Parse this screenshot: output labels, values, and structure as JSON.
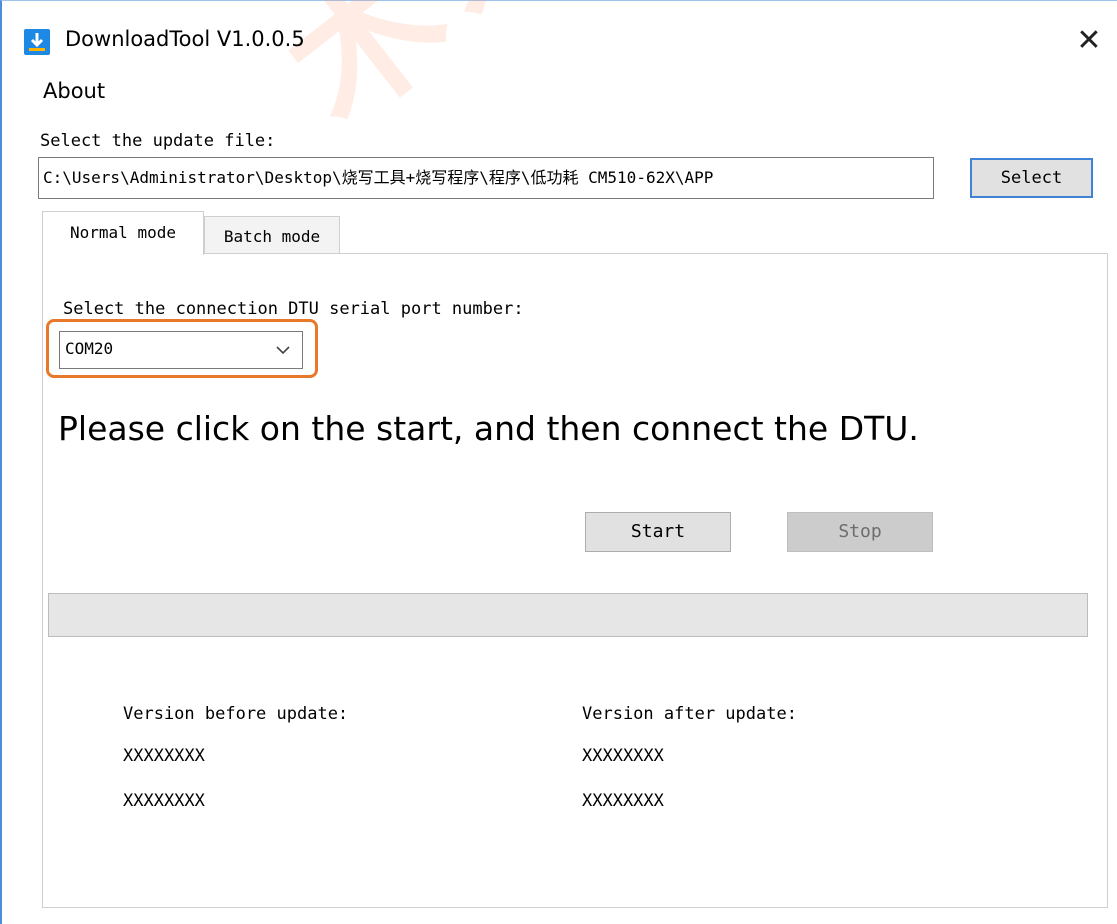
{
  "window": {
    "title": "DownloadTool V1.0.0.5",
    "close_symbol": "✕",
    "icon": "download-app-icon"
  },
  "menu": {
    "about": "About"
  },
  "update_file": {
    "label": "Select the update file:",
    "path": "C:\\Users\\Administrator\\Desktop\\烧写工具+烧写程序\\程序\\低功耗 CM510-62X\\APP",
    "select_button": "Select"
  },
  "tabs": [
    {
      "label": "Normal mode",
      "selected": true
    },
    {
      "label": "Batch mode",
      "selected": false
    }
  ],
  "normal_mode": {
    "port_label": "Select the connection DTU serial port number:",
    "port_value": "COM20",
    "instruction": "Please click on the start, and then connect the DTU.",
    "start_button": "Start",
    "stop_button": "Stop",
    "stop_enabled": false,
    "progress": 0,
    "version_before_label": "Version before update:",
    "version_after_label": "Version after update:",
    "version_before": [
      "XXXXXXXX",
      "XXXXXXXX"
    ],
    "version_after": [
      "XXXXXXXX",
      "XXXXXXXX"
    ]
  },
  "colors": {
    "highlight": "#e8782a",
    "accent": "#3f82d6",
    "app_icon": "#1e88e5"
  }
}
